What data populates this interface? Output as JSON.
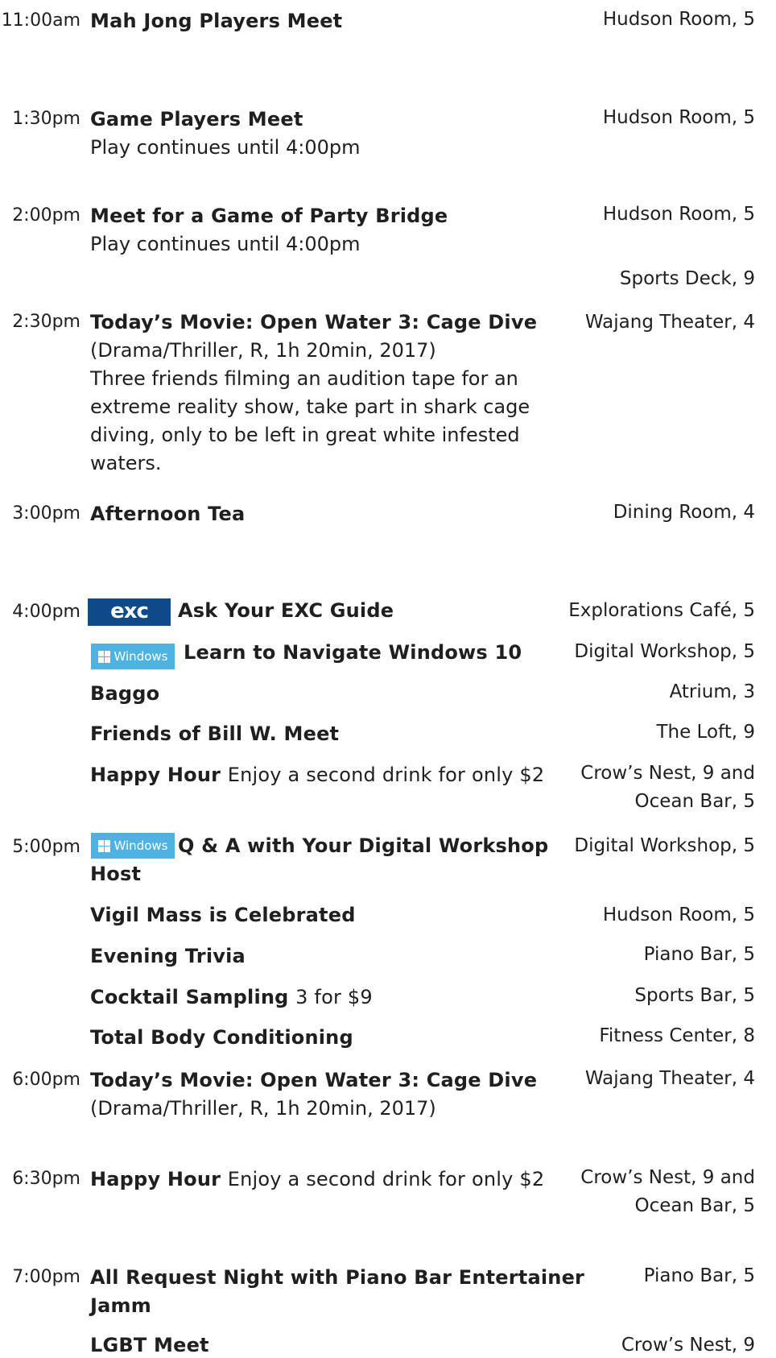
{
  "schedule": [
    {
      "time": "11:00am",
      "title": "Mah Jong Players Meet",
      "location": "Hudson Room, 5"
    },
    {
      "time": "1:30pm",
      "title": "Game Players Meet",
      "detail": "Play continues until 4:00pm",
      "location": "Hudson Room, 5"
    },
    {
      "time": "2:00pm",
      "title": "Meet for a Game of Party Bridge",
      "detail": "Play continues until 4:00pm",
      "location": "Hudson Room, 5",
      "location2": "Sports Deck, 9"
    },
    {
      "time": "2:30pm",
      "title": "Today’s Movie: Open Water 3: Cage Dive",
      "detail": "(Drama/Thriller, R, 1h 20min, 2017)",
      "description": [
        "Three friends filming an audition tape for an",
        "extreme reality show, take part in shark cage",
        "diving, only to be left in great white infested",
        "waters."
      ],
      "location": "Wajang Theater, 4"
    },
    {
      "time": "3:00pm",
      "title": "Afternoon Tea",
      "location": "Dining Room, 4"
    },
    {
      "time": "4:00pm",
      "badge": "exc",
      "title": "Ask Your EXC Guide",
      "location": "Explorations Café, 5"
    },
    {
      "badge": "windows",
      "title": "Learn to Navigate Windows 10",
      "location": "Digital Workshop, 5"
    },
    {
      "title": "Baggo",
      "location": "Atrium, 3"
    },
    {
      "title": "Friends of Bill W. Meet",
      "location": "The Loft, 9"
    },
    {
      "title": "Happy Hour",
      "note": "Enjoy a second drink for only $2",
      "location": "Crow’s Nest, 9 and",
      "location2": "Ocean Bar, 5"
    },
    {
      "time": "5:00pm",
      "badge": "windows",
      "title": "Q & A with Your Digital Workshop",
      "title2": "Host",
      "location": "Digital Workshop, 5"
    },
    {
      "title": "Vigil Mass is Celebrated",
      "location": "Hudson Room, 5"
    },
    {
      "title": "Evening Trivia",
      "location": "Piano Bar, 5"
    },
    {
      "title": "Cocktail Sampling",
      "note": "3 for $9",
      "location": "Sports Bar, 5"
    },
    {
      "title": "Total Body Conditioning",
      "location": "Fitness Center, 8"
    },
    {
      "time": "6:00pm",
      "title": "Today’s Movie: Open Water 3: Cage Dive",
      "detail": "(Drama/Thriller, R, 1h 20min, 2017)",
      "location": "Wajang Theater, 4"
    },
    {
      "time": "6:30pm",
      "title": "Happy Hour",
      "note": "Enjoy a second drink for only $2",
      "location": "Crow’s Nest, 9 and",
      "location2": "Ocean Bar, 5"
    },
    {
      "time": "7:00pm",
      "title": "All Request Night with Piano Bar Entertainer",
      "title2": "Jamm",
      "location": "Piano Bar, 5"
    },
    {
      "title": "LGBT Meet",
      "location": "Crow’s Nest, 9"
    }
  ],
  "badges": {
    "exc_text": "exc",
    "windows_text": "Windows",
    "exc_color": "#0f4a8a",
    "windows_color": "#4eb3e0"
  }
}
